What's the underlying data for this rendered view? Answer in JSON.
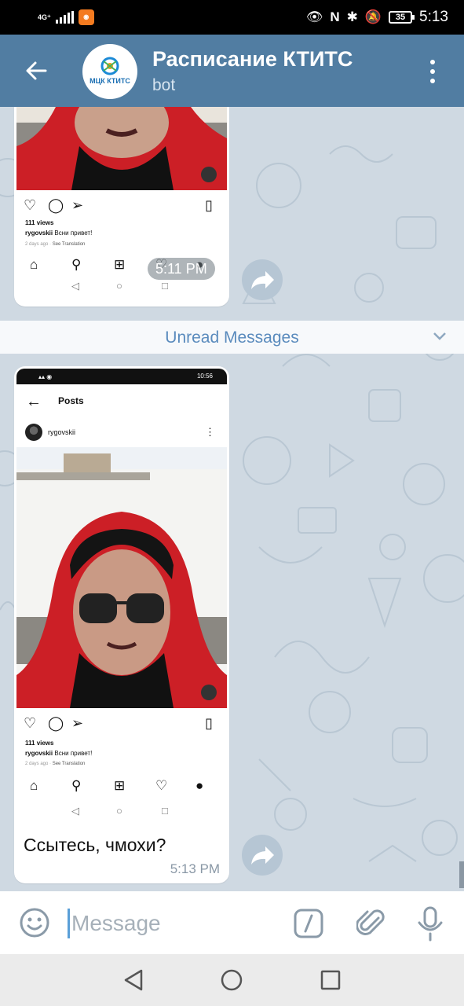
{
  "status_bar": {
    "network": "4G⁺",
    "time": "5:13",
    "battery": "35"
  },
  "header": {
    "title": "Расписание КТИТС",
    "subtitle": "bot",
    "avatar_text": "МЦК КТИТС"
  },
  "messages": [
    {
      "type": "screenshot",
      "views": "111 views",
      "caption_user": "rygovskii",
      "caption_text": "Всни привет!",
      "meta": "2 days ago · ",
      "see_translation": "See Translation",
      "time": "5:11 PM"
    },
    {
      "type": "screenshot_with_text",
      "status_time": "10:56",
      "topbar_title": "Posts",
      "username": "rygovskii",
      "views": "111 views",
      "caption_user": "rygovskii",
      "caption_text": "Всни привет!",
      "meta": "2 days ago · ",
      "see_translation": "See Translation",
      "text": "Ссытесь, чмохи?",
      "time": "5:13 PM"
    }
  ],
  "unread_divider": "Unread Messages",
  "input": {
    "placeholder": "Message"
  },
  "colors": {
    "header": "#517da2",
    "chat_bg": "#cfd9e2",
    "accent": "#5a8bbd"
  }
}
